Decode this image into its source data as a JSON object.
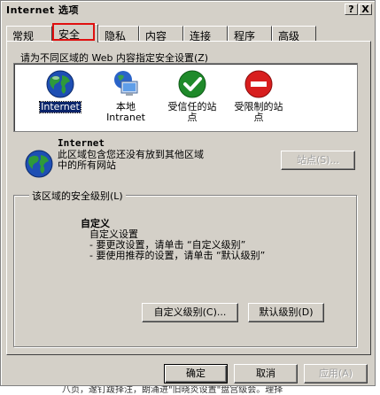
{
  "window": {
    "title": "Internet 选项",
    "help_btn": "?",
    "close_btn": "X"
  },
  "tabs": [
    {
      "label": "常规"
    },
    {
      "label": "安全"
    },
    {
      "label": "隐私"
    },
    {
      "label": "内容"
    },
    {
      "label": "连接"
    },
    {
      "label": "程序"
    },
    {
      "label": "高级"
    }
  ],
  "security": {
    "zone_prompt": "请为不同区域的 Web 内容指定安全设置(Z)",
    "zones": [
      {
        "label": "Internet",
        "icon": "globe-icon",
        "selected": true
      },
      {
        "label": "本地\nIntranet",
        "icon": "intranet-monitor-icon"
      },
      {
        "label": "受信任的站\n点",
        "icon": "trusted-check-icon"
      },
      {
        "label": "受限制的站\n点",
        "icon": "restricted-icon"
      }
    ],
    "selected_zone_name": "Internet",
    "selected_zone_desc": "此区域包含您还没有放到其他区域\n中的所有网站",
    "sites_button": "站点(S)...",
    "level_group_title": "该区域的安全级别(L)",
    "level_name": "自定义",
    "level_lines": [
      "自定义设置",
      "- 要更改设置，请单击 “自定义级别”",
      "- 要使用推荐的设置，请单击 “默认级别”"
    ],
    "custom_level_button": "自定义级别(C)...",
    "default_level_button": "默认级别(D)"
  },
  "footer": {
    "ok": "确定",
    "cancel": "取消",
    "apply": "应用(A)"
  },
  "background_text": "八页，邃钉跋择注，朗涌进\"旧晓炎设置\"盘宫级会。理择"
}
